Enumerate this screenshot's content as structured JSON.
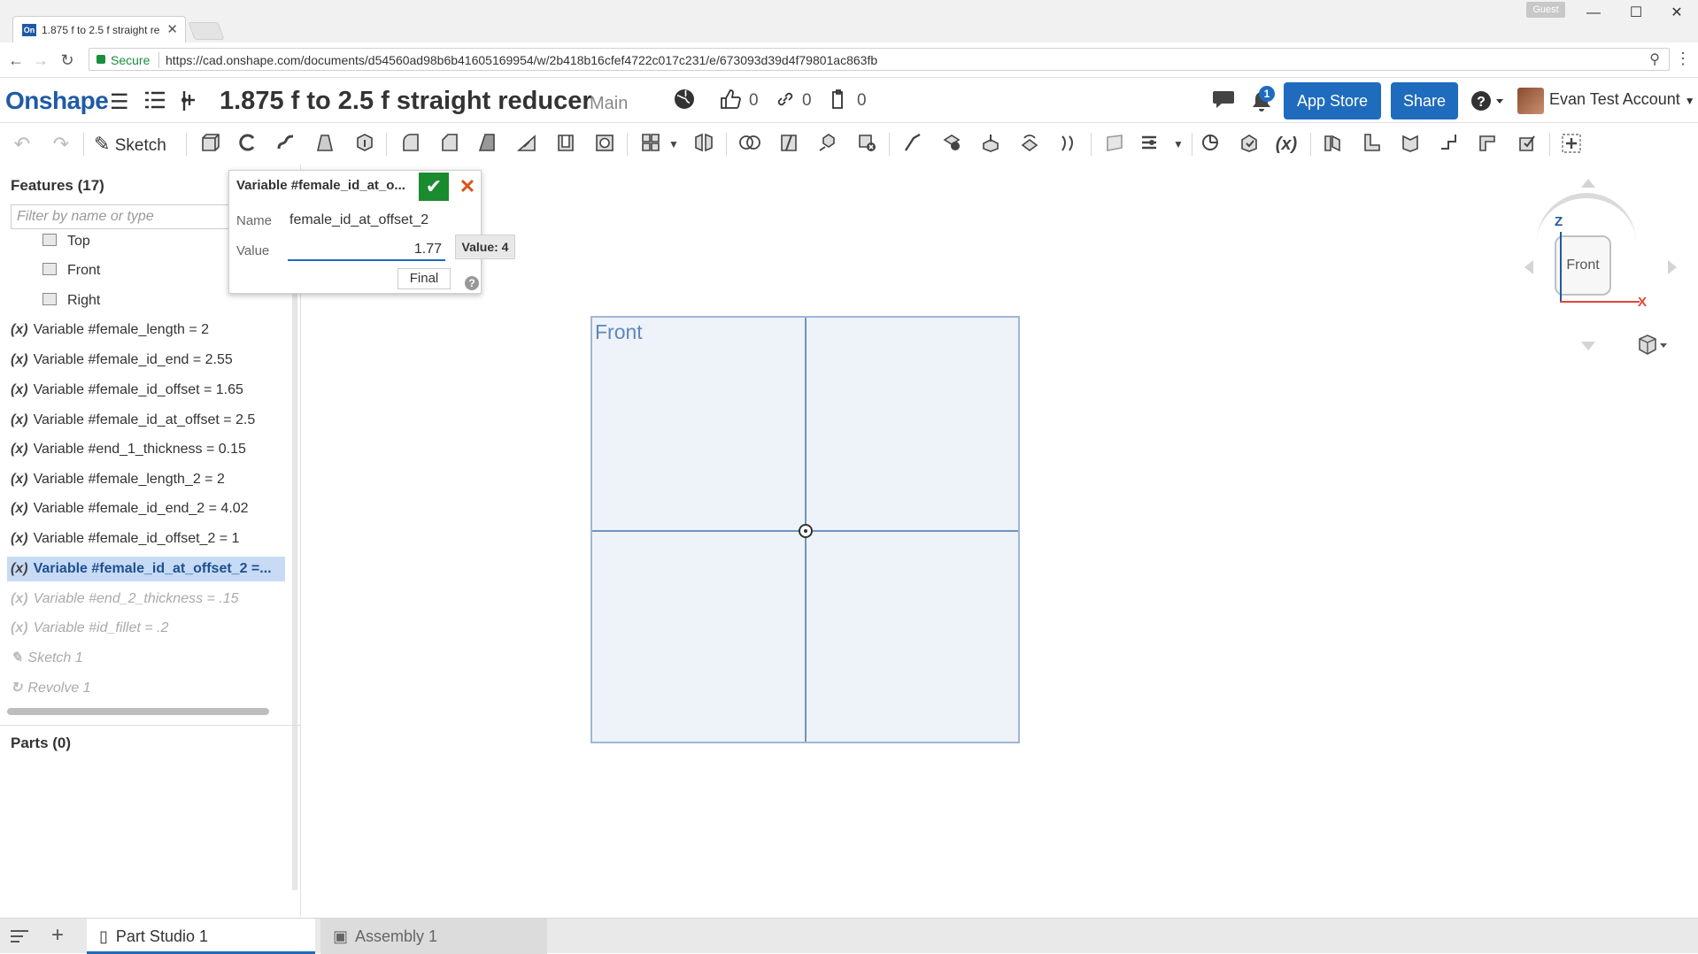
{
  "browser": {
    "tab_title": "1.875 f to 2.5 f straight re",
    "tab_favicon": "On",
    "guest_label": "Guest",
    "secure_label": "Secure",
    "url": "https://cad.onshape.com/documents/d54560ad98b6b41605169954/w/2b418b16cfef4722c017c231/e/673093d39d4f79801ac863fb"
  },
  "header": {
    "logo": "Onshape",
    "document_title": "1.875 f to 2.5 f straight reducer",
    "branch": "Main",
    "likes_count": "0",
    "links_count": "0",
    "copies_count": "0",
    "notification_count": "1",
    "app_store_label": "App Store",
    "share_label": "Share",
    "user_name": "Evan Test Account"
  },
  "toolbar": {
    "sketch_label": "Sketch",
    "variable_icon_label": "(x)"
  },
  "features": {
    "header": "Features (17)",
    "filter_placeholder": "Filter by name or type",
    "planes": [
      "Top",
      "Front",
      "Right"
    ],
    "items": [
      "Variable #female_length = 2",
      "Variable #female_id_end = 2.55",
      "Variable #female_id_offset = 1.65",
      "Variable #female_id_at_offset = 2.5",
      "Variable #end_1_thickness = 0.15",
      "Variable #female_length_2 = 2",
      "Variable #female_id_end_2 = 4.02",
      "Variable #female_id_offset_2 = 1",
      "Variable #female_id_at_offset_2 =...",
      "Variable #end_2_thickness = .15",
      "Variable #id_fillet = .2",
      "Sketch 1",
      "Revolve 1"
    ],
    "fx_symbol": "(x)",
    "parts_header": "Parts (0)"
  },
  "dialog": {
    "title": "Variable #female_id_at_o...",
    "name_label": "Name",
    "name_value": "female_id_at_offset_2",
    "value_label": "Value",
    "value_value": "1.77",
    "final_label": "Final",
    "tooltip": "Value: 4"
  },
  "canvas": {
    "plane_label": "Front",
    "viewcube_face": "Front",
    "axis_z": "Z",
    "axis_x": "X"
  },
  "bottom_tabs": {
    "part_studio": "Part Studio 1",
    "assembly": "Assembly 1"
  },
  "colors": {
    "brand_blue": "#1f5aa6",
    "button_blue": "#1f6bbd",
    "confirm_green": "#1a8b2f",
    "cancel_orange": "#d9541e",
    "selection_bg": "#c7dbf5"
  }
}
